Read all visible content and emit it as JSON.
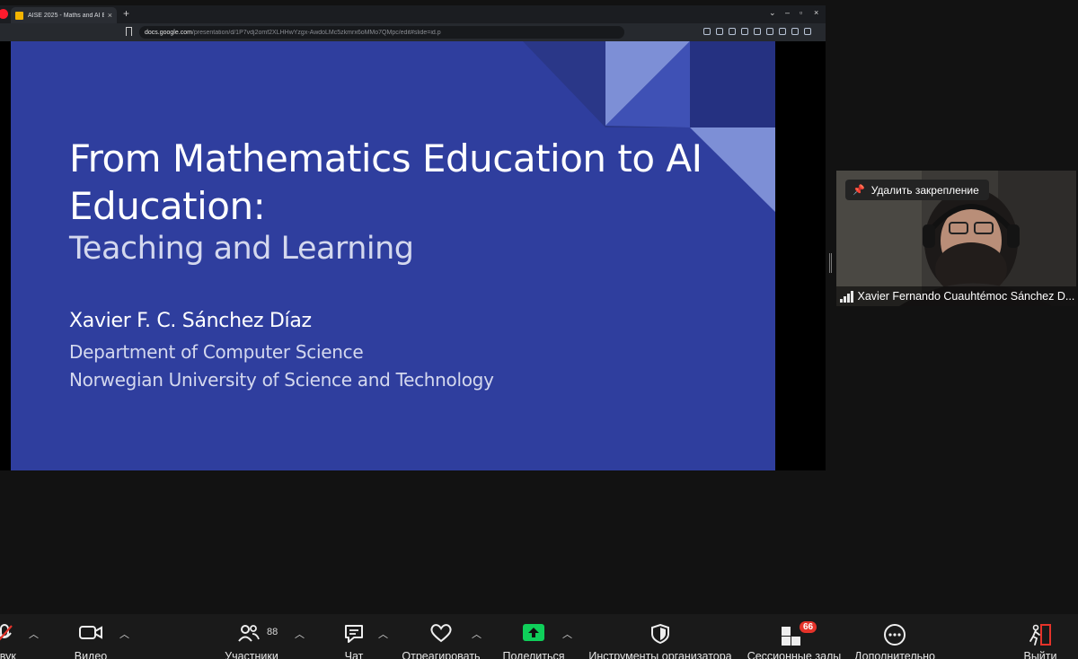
{
  "browser": {
    "tab_title": "AISE 2025 - Maths and AI E",
    "url_host": "docs.google.com",
    "url_path": "/presentation/d/1P7vdj2omf2XLHHwYzgx-AwdoLMc5zkmrx6oMMo7QMpc/edit#slide=id.p"
  },
  "slide": {
    "title": "From Mathematics Education to AI Education:",
    "subtitle": "Teaching and Learning",
    "author": "Xavier F. C. Sánchez Díaz",
    "department": "Department of Computer Science",
    "university": "Norwegian University of Science and Technology"
  },
  "participant": {
    "pin_label": "Удалить закрепление",
    "name": "Xavier Fernando Cuauhtémoc Sánchez D..."
  },
  "toolbar": {
    "audio_label": "Звук",
    "video_label": "Видео",
    "participants_label": "Участники",
    "participants_count": "88",
    "chat_label": "Чат",
    "react_label": "Отреагировать",
    "share_label": "Поделиться",
    "host_tools_label": "Инструменты организатора",
    "breakout_label": "Сессионные залы",
    "breakout_badge": "66",
    "more_label": "Дополнительно",
    "leave_label": "Выйти"
  },
  "colors": {
    "slide_bg": "#2f3e9e",
    "share_green": "#0fcf5a",
    "badge_red": "#e5332a"
  }
}
